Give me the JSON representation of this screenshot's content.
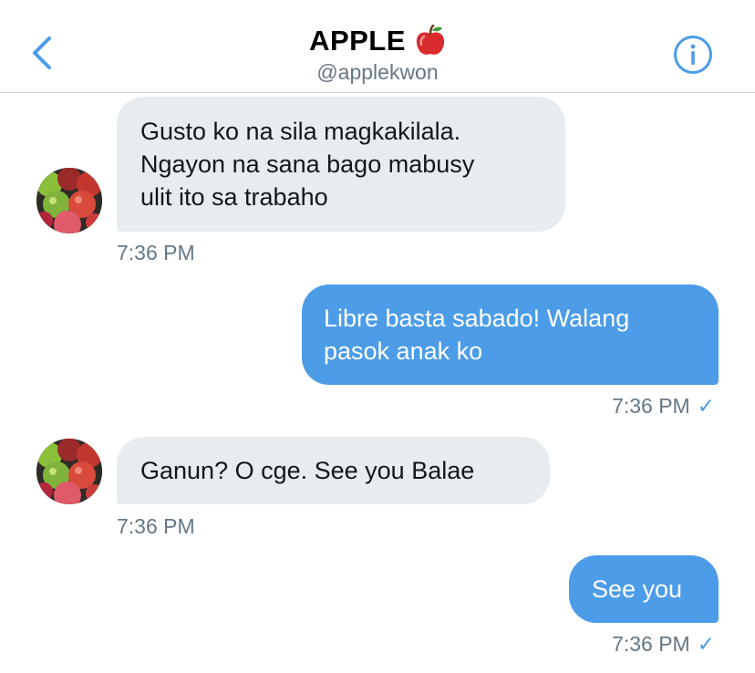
{
  "header": {
    "title": "APPLE",
    "handle": "@applekwon",
    "back_icon": "chevron-left-icon",
    "info_icon": "info-icon",
    "title_icon": "apple-emoji-icon",
    "accent_color": "#4c9ce8"
  },
  "messages": [
    {
      "direction": "incoming",
      "lines": [
        "Gusto ko na sila magkakilala.",
        "Ngayon na sana bago mabusy",
        "ulit ito sa trabaho"
      ],
      "time": "7:36 PM"
    },
    {
      "direction": "outgoing",
      "lines": [
        "Libre basta sabado! Walang",
        "pasok anak ko"
      ],
      "time": "7:36 PM",
      "read_check": "✓"
    },
    {
      "direction": "incoming",
      "lines": [
        "Ganun? O cge. See you Balae"
      ],
      "time": "7:36 PM"
    },
    {
      "direction": "outgoing",
      "lines": [
        "See you"
      ],
      "time": "7:36 PM",
      "read_check": "✓"
    }
  ]
}
